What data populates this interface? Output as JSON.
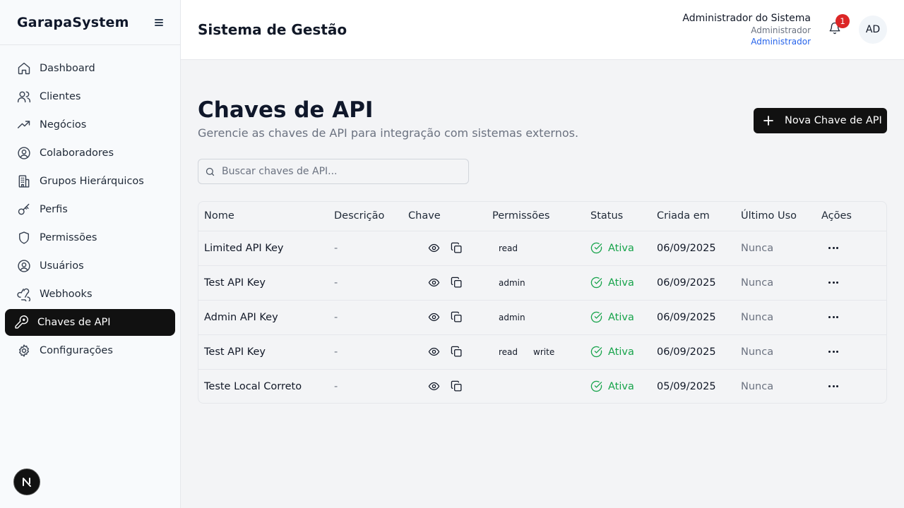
{
  "sidebar": {
    "brand": "GarapaSystem",
    "items": [
      {
        "label": "Dashboard",
        "icon": "home-icon"
      },
      {
        "label": "Clientes",
        "icon": "users-icon"
      },
      {
        "label": "Negócios",
        "icon": "trending-up-icon"
      },
      {
        "label": "Colaboradores",
        "icon": "user-circle-icon"
      },
      {
        "label": "Grupos Hierárquicos",
        "icon": "building-icon"
      },
      {
        "label": "Perfis",
        "icon": "key-icon"
      },
      {
        "label": "Permissões",
        "icon": "shield-icon"
      },
      {
        "label": "Usuários",
        "icon": "user-circle-icon"
      },
      {
        "label": "Webhooks",
        "icon": "webhook-icon"
      },
      {
        "label": "Chaves de API",
        "icon": "key-round-icon",
        "active": true
      },
      {
        "label": "Configurações",
        "icon": "gear-icon"
      }
    ]
  },
  "header": {
    "title": "Sistema de Gestão",
    "user_name": "Administrador do Sistema",
    "user_role": "Administrador",
    "user_role_link": "Administrador",
    "notification_count": "1",
    "avatar_initials": "AD"
  },
  "main": {
    "title": "Chaves de API",
    "subtitle": "Gerencie as chaves de API para integração com sistemas externos.",
    "new_button": "Nova Chave de API",
    "search_placeholder": "Buscar chaves de API..."
  },
  "table": {
    "headers": [
      "Nome",
      "Descrição",
      "Chave",
      "Permissões",
      "Status",
      "Criada em",
      "Último Uso",
      "Ações"
    ],
    "rows": [
      {
        "name": "Limited API Key",
        "description": "-",
        "permissions": [
          "read"
        ],
        "status": "Ativa",
        "created": "06/09/2025",
        "last_used": "Nunca"
      },
      {
        "name": "Test API Key",
        "description": "-",
        "permissions": [
          "admin"
        ],
        "status": "Ativa",
        "created": "06/09/2025",
        "last_used": "Nunca"
      },
      {
        "name": "Admin API Key",
        "description": "-",
        "permissions": [
          "admin"
        ],
        "status": "Ativa",
        "created": "06/09/2025",
        "last_used": "Nunca"
      },
      {
        "name": "Test API Key",
        "description": "-",
        "permissions": [
          "read",
          "write"
        ],
        "status": "Ativa",
        "created": "06/09/2025",
        "last_used": "Nunca"
      },
      {
        "name": "Teste Local Correto",
        "description": "-",
        "permissions": [],
        "status": "Ativa",
        "created": "05/09/2025",
        "last_used": "Nunca"
      }
    ]
  },
  "colors": {
    "accent": "#111111",
    "status_active": "#16a34a",
    "notification": "#dc2626",
    "link": "#2563eb"
  }
}
